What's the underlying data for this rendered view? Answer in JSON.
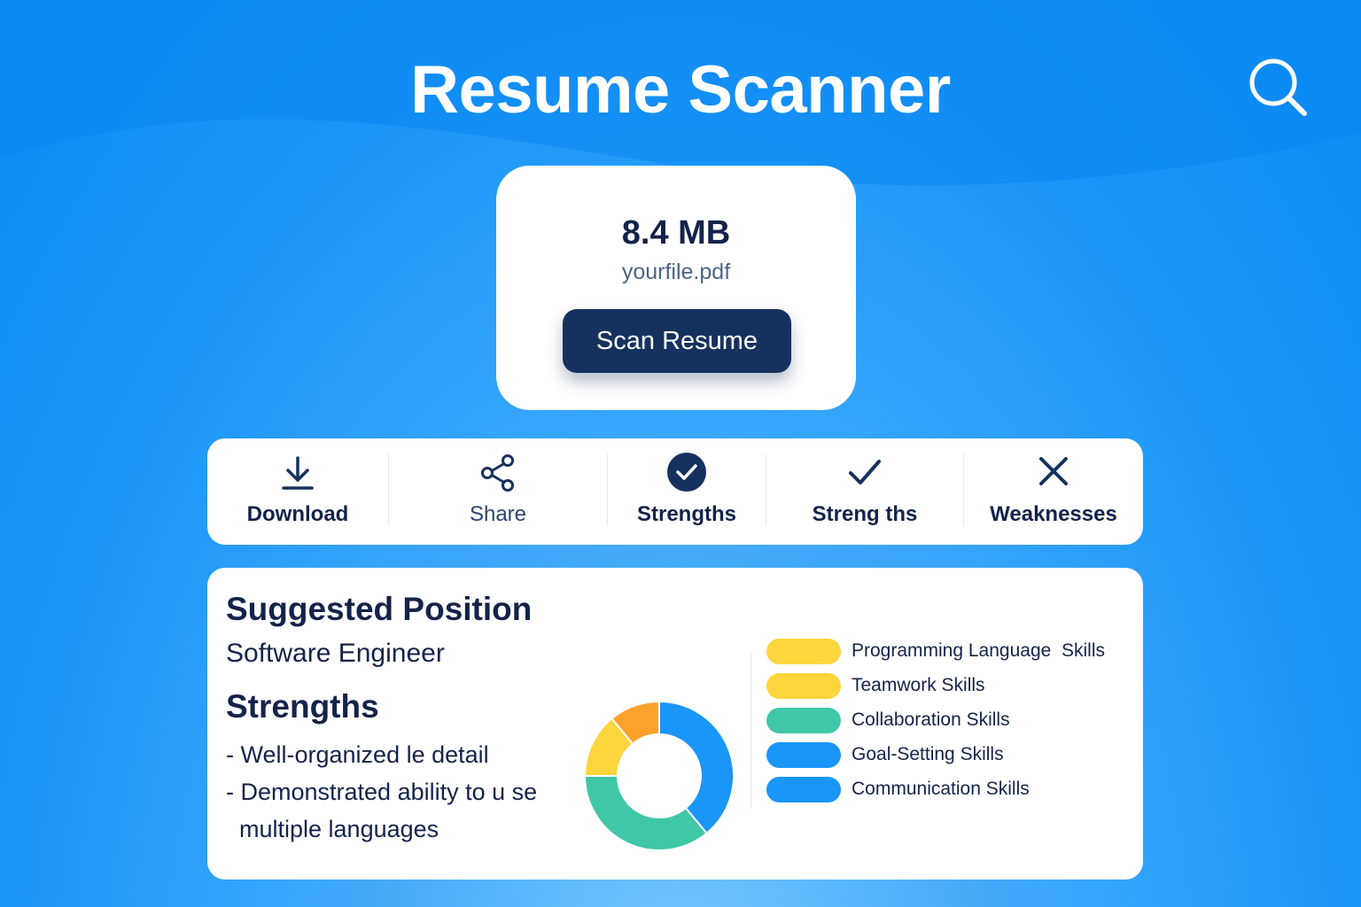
{
  "app": {
    "title": "Resume Scanner"
  },
  "colors": {
    "primary_dark": "#16315e",
    "text_dark": "#14234a",
    "background_blue": "#1a96f8",
    "segment_yellow": "#fdd53c",
    "segment_green": "#40c7a8",
    "segment_blue": "#1a96f8",
    "segment_orange": "#fca12a"
  },
  "upload": {
    "file_size": "8.4 MB",
    "file_name": "yourfile.pdf",
    "scan_button": "Scan Resume"
  },
  "toolbar": {
    "items": [
      {
        "label": "Download",
        "icon": "download-icon"
      },
      {
        "label": "Share",
        "icon": "share-icon"
      },
      {
        "label": "Strengths",
        "icon": "check-circle-icon"
      },
      {
        "label": "Streng ths",
        "icon": "checkmark-icon"
      },
      {
        "label": "Weaknesses",
        "icon": "close-icon"
      }
    ]
  },
  "results": {
    "position_heading": "Suggested Position",
    "position_value": "Software Engineer",
    "strengths_heading": "Strengths",
    "strengths": [
      "- Well-organized le detail",
      "- Demonstrated ability to u se multiple languages"
    ]
  },
  "skills": {
    "legend": [
      {
        "label": "Programming Language  Skills",
        "color": "#fdd53c"
      },
      {
        "label": "Teamwork Skills",
        "color": "#fdd53c"
      },
      {
        "label": "Collaboration Skills",
        "color": "#40c7a8"
      },
      {
        "label": "Goal-Setting Skills",
        "color": "#1a96f8"
      },
      {
        "label": "Communication Skills",
        "color": "#1a96f8"
      }
    ],
    "donut_segments": [
      {
        "color": "#1a96f8",
        "value": 39
      },
      {
        "color": "#40c7a8",
        "value": 36
      },
      {
        "color": "#fdd53c",
        "value": 14
      },
      {
        "color": "#fca12a",
        "value": 11
      }
    ]
  }
}
